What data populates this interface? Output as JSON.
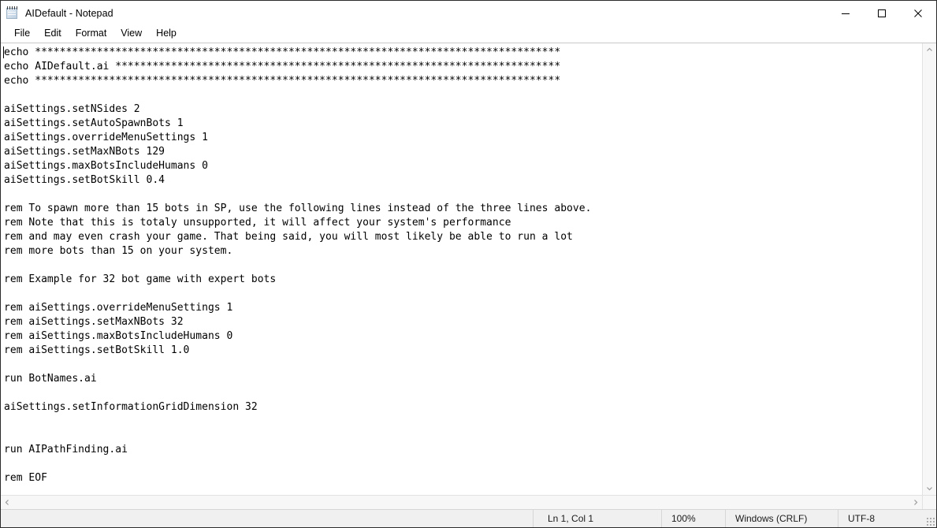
{
  "window": {
    "title": "AIDefault - Notepad",
    "icon": "notepad-icon",
    "controls": {
      "minimize": "minimize-icon",
      "maximize": "maximize-icon",
      "close": "close-icon"
    }
  },
  "menubar": {
    "items": [
      {
        "label": "File"
      },
      {
        "label": "Edit"
      },
      {
        "label": "Format"
      },
      {
        "label": "View"
      },
      {
        "label": "Help"
      }
    ]
  },
  "editor": {
    "content": "echo *************************************************************************************\necho AIDefault.ai ************************************************************************\necho *************************************************************************************\n\naiSettings.setNSides 2\naiSettings.setAutoSpawnBots 1\naiSettings.overrideMenuSettings 1\naiSettings.setMaxNBots 129\naiSettings.maxBotsIncludeHumans 0\naiSettings.setBotSkill 0.4\n\nrem To spawn more than 15 bots in SP, use the following lines instead of the three lines above.\nrem Note that this is totaly unsupported, it will affect your system's performance\nrem and may even crash your game. That being said, you will most likely be able to run a lot\nrem more bots than 15 on your system.\n\nrem Example for 32 bot game with expert bots\n\nrem aiSettings.overrideMenuSettings 1\nrem aiSettings.setMaxNBots 32\nrem aiSettings.maxBotsIncludeHumans 0\nrem aiSettings.setBotSkill 1.0\n\nrun BotNames.ai\n\naiSettings.setInformationGridDimension 32\n\n\nrun AIPathFinding.ai\n\nrem EOF"
  },
  "scrollbars": {
    "vertical": {
      "up_arrow": "chevron-up-icon",
      "down_arrow": "chevron-down-icon"
    },
    "horizontal": {
      "left_arrow": "chevron-left-icon",
      "right_arrow": "chevron-right-icon"
    }
  },
  "statusbar": {
    "cursor_position": "Ln 1, Col 1",
    "zoom": "100%",
    "line_ending": "Windows (CRLF)",
    "encoding": "UTF-8"
  }
}
